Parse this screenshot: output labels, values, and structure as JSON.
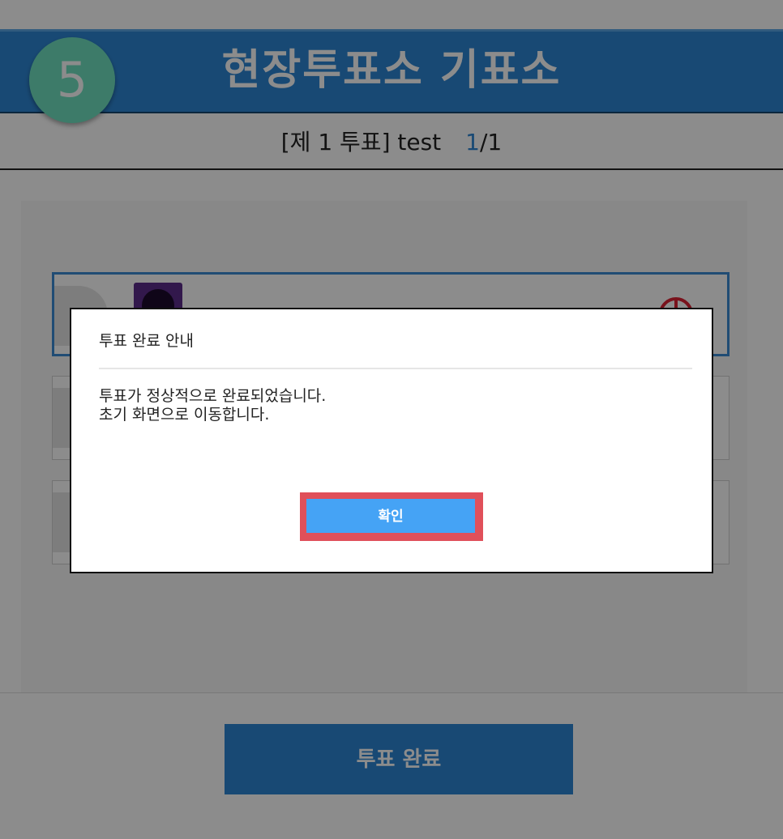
{
  "header": {
    "step_number": "5",
    "title": "현장투표소 기표소"
  },
  "subheader": {
    "vote_label": "[제 1 투표] test",
    "page_current": "1",
    "page_total": "/1"
  },
  "main": {
    "candidates": [
      {
        "state": "selected"
      },
      {
        "state": "unselected"
      },
      {
        "state": "unselected"
      }
    ],
    "complete_button_label": "투표 완료"
  },
  "dialog": {
    "title": "투표 완료 안내",
    "message_line1": "투표가 정상적으로 완료되었습니다.",
    "message_line2": "초기 화면으로 이동합니다.",
    "confirm_label": "확인"
  },
  "colors": {
    "header_blue": "#2d86d4",
    "step_badge": "#6fe0c0",
    "confirm_button": "#45a3f5",
    "highlight": "#e0505a"
  },
  "icons": {
    "vote_mark": "vote-stamp-icon",
    "candidate_photo": "candidate-photo-icon"
  }
}
